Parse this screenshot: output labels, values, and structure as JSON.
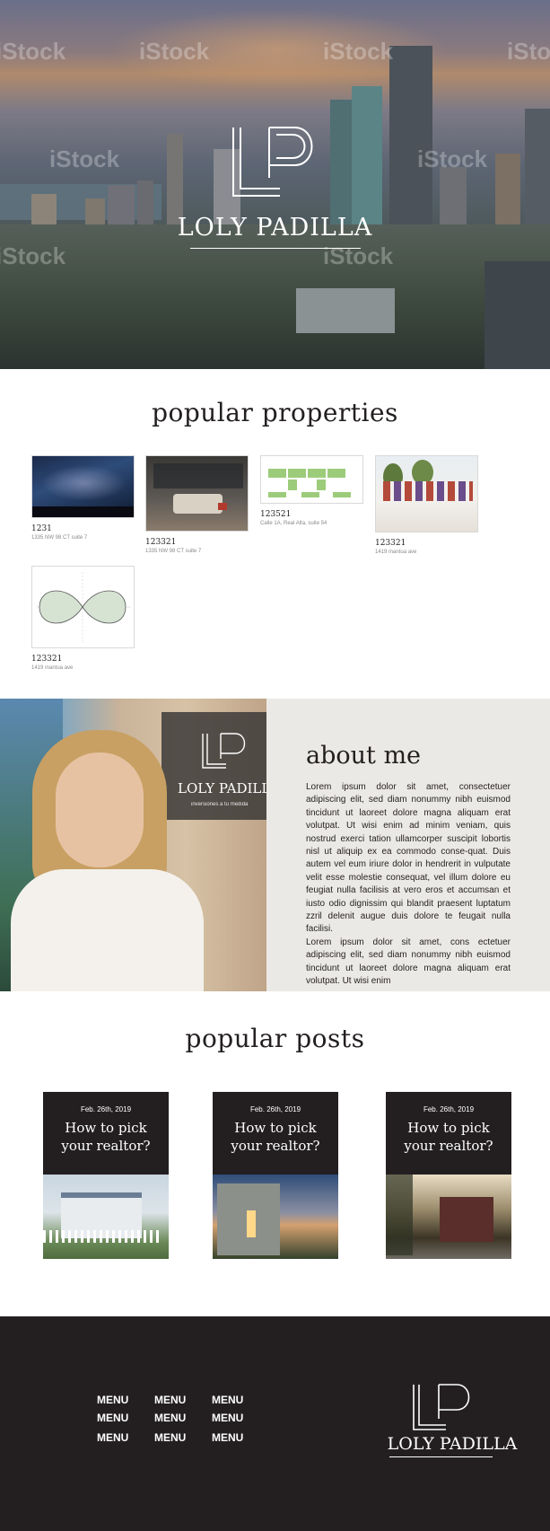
{
  "hero": {
    "brand_name": "LOLY PADILLA",
    "watermark": "iStock",
    "logo_initials": "LP"
  },
  "properties": {
    "title": "popular properties",
    "items": [
      {
        "id": "1231",
        "address": "1335 NW 98 CT suite 7"
      },
      {
        "id": "123321",
        "address": "1335 NW 98 CT suite 7"
      },
      {
        "id": "123521",
        "address": "Calle 1A, Real Alta, suite 54"
      },
      {
        "id": "123321",
        "address": "1419 mantua ave"
      },
      {
        "id": "123321",
        "address": "1419 mantua ave"
      }
    ]
  },
  "about": {
    "title": "about me",
    "photo_brand": "LOLY PADILLA",
    "photo_tagline": "inversiones a tu medida",
    "paragraphs": [
      "Lorem ipsum dolor sit amet, consectetuer adipiscing elit, sed diam nonummy nibh euismod tincidunt ut laoreet dolore magna aliquam erat volutpat. Ut wisi enim ad minim veniam, quis nostrud exerci tation ullamcorper suscipit lobortis nisl ut aliquip ex ea commodo conse-quat. Duis autem vel eum iriure dolor in hendrerit in vulputate velit esse molestie consequat, vel illum dolore eu feugiat nulla facilisis at vero eros et accumsan et iusto odio dignissim qui blandit praesent luptatum zzril delenit augue duis dolore te feugait nulla facilisi.",
      "Lorem ipsum dolor sit amet, cons ectetuer adipiscing elit, sed diam nonummy nibh euismod tincidunt ut laoreet dolore magna aliquam erat volutpat. Ut wisi enim"
    ]
  },
  "posts": {
    "title": "popular posts",
    "items": [
      {
        "date": "Feb. 26th, 2019",
        "line1": "How to pick",
        "line2": "your realtor?"
      },
      {
        "date": "Feb. 26th, 2019",
        "line1": "How to pick",
        "line2": "your realtor?"
      },
      {
        "date": "Feb. 26th, 2019",
        "line1": "How to pick",
        "line2": "your realtor?"
      }
    ]
  },
  "footer": {
    "menu": [
      "MENU",
      "MENU",
      "MENU",
      "MENU",
      "MENU",
      "MENU",
      "MENU",
      "MENU",
      "MENU"
    ],
    "brand_name": "LOLY PADILLA",
    "logo_initials": "LP"
  },
  "colors": {
    "dark": "#231f20",
    "panel": "#ebe9e5",
    "white": "#ffffff"
  }
}
